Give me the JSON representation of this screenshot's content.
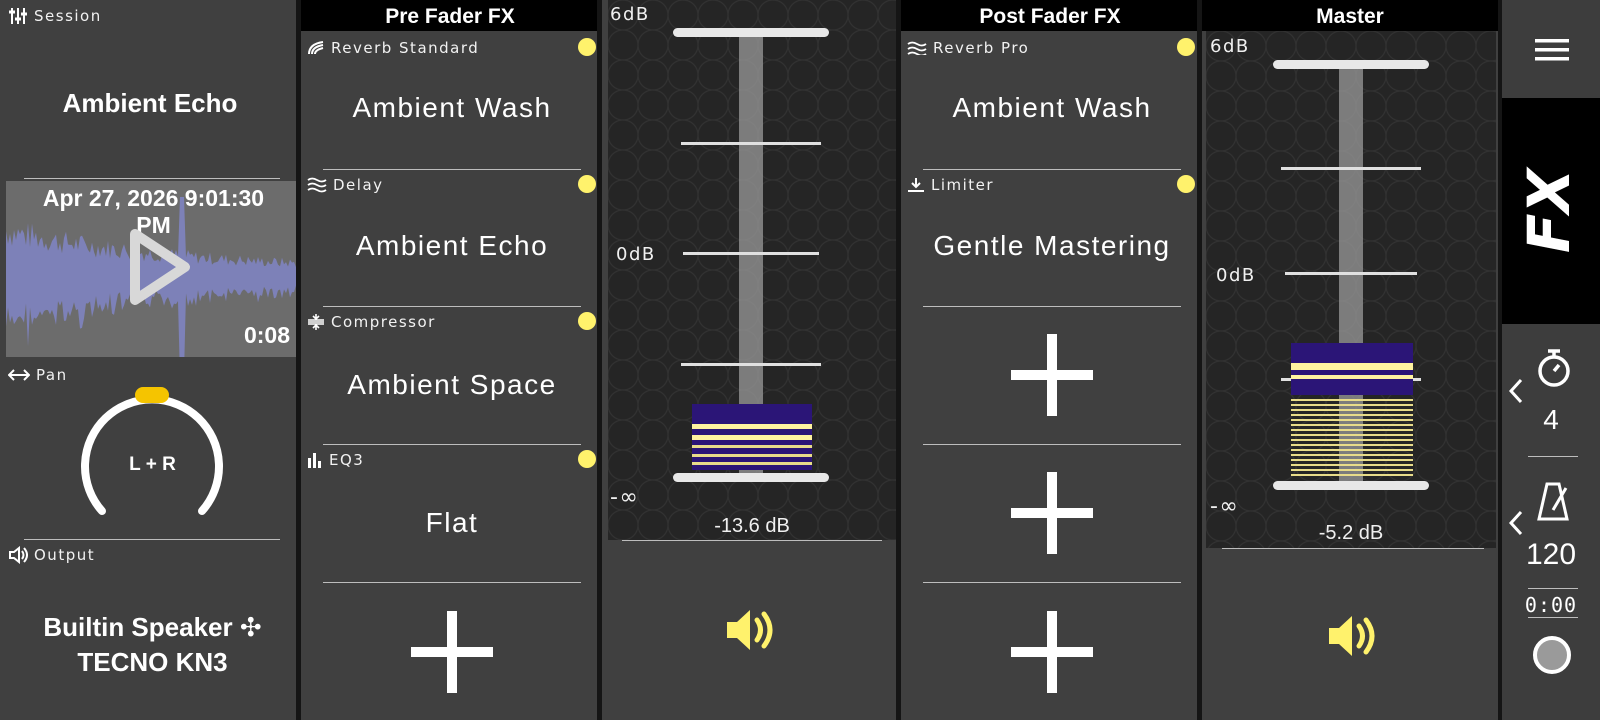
{
  "session": {
    "label": "Session",
    "title": "Ambient Echo",
    "date": "Apr 27, 2026 9:01:30 PM",
    "duration": "0:08",
    "pan_label": "Pan",
    "pan_value": "L + R",
    "output_label": "Output",
    "output_device": "Builtin Speaker ✣ TECNO KN3"
  },
  "pre_fader": {
    "title": "Pre Fader FX",
    "slots": [
      {
        "effect": "Reverb Standard",
        "preset": "Ambient Wash",
        "icon": "reverb-icon"
      },
      {
        "effect": "Delay",
        "preset": "Ambient Echo",
        "icon": "delay-icon"
      },
      {
        "effect": "Compressor",
        "preset": "Ambient Space",
        "icon": "compressor-icon"
      },
      {
        "effect": "EQ3",
        "preset": "Flat",
        "icon": "eq-icon"
      }
    ]
  },
  "channel_fader": {
    "top_label": "6dB",
    "mid_label": "0dB",
    "bottom_label": "-∞",
    "value": "-13.6 dB"
  },
  "post_fader": {
    "title": "Post Fader FX",
    "slots": [
      {
        "effect": "Reverb Pro",
        "preset": "Ambient Wash",
        "icon": "reverb-icon"
      },
      {
        "effect": "Limiter",
        "preset": "Gentle Mastering",
        "icon": "limiter-icon"
      }
    ]
  },
  "master": {
    "title": "Master",
    "top_label": "6dB",
    "mid_label": "0dB",
    "bottom_label": "-∞",
    "value": "-5.2 dB"
  },
  "rail": {
    "countdown": "4",
    "tempo": "120",
    "time": "0:00"
  },
  "colors": {
    "accent_yellow": "#fff26c",
    "meter_purple": "#3a1f8c",
    "panel": "#404040"
  }
}
